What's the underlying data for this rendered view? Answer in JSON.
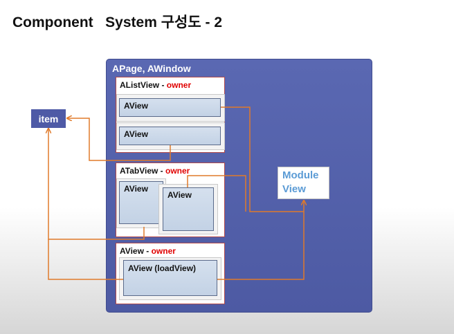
{
  "title": "Component   System 구성도 - 2",
  "container": {
    "label": "APage, AWindow"
  },
  "item": {
    "label": "item"
  },
  "module": {
    "line1": "Module",
    "line2": "View"
  },
  "list_view": {
    "name": "AListView - ",
    "owner": "owner",
    "views": [
      "AView",
      "AView"
    ]
  },
  "tab_view": {
    "name": "ATabView - ",
    "owner": "owner",
    "views": [
      "AView",
      "AView"
    ]
  },
  "a_view": {
    "name": "AView - ",
    "owner": "owner",
    "inner": "AView (loadView)"
  },
  "colors": {
    "container": "#5a68b2",
    "arrow": "#e07a2a",
    "owner": "#e00000",
    "module_text": "#5b9bd5"
  }
}
